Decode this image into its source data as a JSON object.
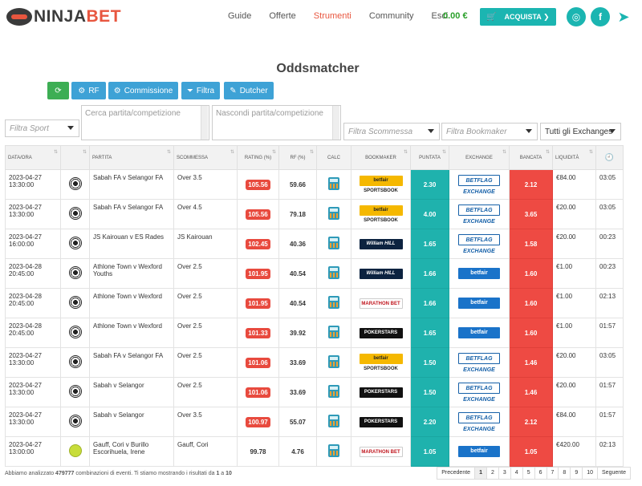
{
  "nav": {
    "logo_prefix": "NINJA",
    "logo_suffix": "BET",
    "links": [
      "Guide",
      "Offerte",
      "Strumenti",
      "Community",
      "Esci"
    ],
    "active_link": "Strumenti",
    "balance": "0.00 €",
    "buy_label": "ACQUISTA ❯",
    "social": [
      "instagram-icon",
      "facebook-icon",
      "telegram-icon"
    ]
  },
  "title": "Oddsmatcher",
  "toolbar": {
    "rf_label": "RF",
    "commission_label": "Commissione",
    "filter_label": "Filtra",
    "dutcher_label": "Dutcher"
  },
  "filters": {
    "sport_placeholder": "Filtra Sport",
    "search_placeholder": "Cerca partita/competizione",
    "hide_placeholder": "Nascondi partita/competizione",
    "bet_placeholder": "Filtra Scommessa",
    "bookmaker_placeholder": "Filtra Bookmaker",
    "exchange_value": "Tutti gli Exchanges"
  },
  "table": {
    "headers": [
      "DATA/ORA",
      "",
      "PARTITA",
      "SCOMMESSA",
      "RATING (%)",
      "RF (%)",
      "CALC",
      "BOOKMAKER",
      "PUNTATA",
      "EXCHANGE",
      "BANCATA",
      "LIQUIDITÀ",
      ""
    ],
    "rows": [
      {
        "date": "2023-04-27",
        "time": "13:30:00",
        "sport": "football",
        "match": "Sabah FA v Selangor FA",
        "bet": "Over 3.5",
        "rating": "105.56",
        "rating_hl": true,
        "rf": "59.66",
        "bookmaker": "betfair SPORTSBOOK",
        "bk": "betfair-sb",
        "back": "2.30",
        "exchange": "BETFLAG EXCHANGE",
        "ex": "betflag",
        "lay": "2.12",
        "liquidity": "€84.00",
        "clock": "03:05"
      },
      {
        "date": "2023-04-27",
        "time": "13:30:00",
        "sport": "football",
        "match": "Sabah FA v Selangor FA",
        "bet": "Over 4.5",
        "rating": "105.56",
        "rating_hl": true,
        "rf": "79.18",
        "bookmaker": "betfair SPORTSBOOK",
        "bk": "betfair-sb",
        "back": "4.00",
        "exchange": "BETFLAG EXCHANGE",
        "ex": "betflag",
        "lay": "3.65",
        "liquidity": "€20.00",
        "clock": "03:05"
      },
      {
        "date": "2023-04-27",
        "time": "16:00:00",
        "sport": "football",
        "match": "JS Kairouan v ES Rades",
        "bet": "JS Kairouan",
        "rating": "102.45",
        "rating_hl": true,
        "rf": "40.36",
        "bookmaker": "William HILL",
        "bk": "williamhill",
        "back": "1.65",
        "exchange": "BETFLAG EXCHANGE",
        "ex": "betflag",
        "lay": "1.58",
        "liquidity": "€20.00",
        "clock": "00:23"
      },
      {
        "date": "2023-04-28",
        "time": "20:45:00",
        "sport": "football",
        "match": "Athlone Town v Wexford Youths",
        "bet": "Over 2.5",
        "rating": "101.95",
        "rating_hl": true,
        "rf": "40.54",
        "bookmaker": "William HILL",
        "bk": "williamhill",
        "back": "1.66",
        "exchange": "betfair",
        "ex": "betfair",
        "lay": "1.60",
        "liquidity": "€1.00",
        "clock": "00:23"
      },
      {
        "date": "2023-04-28",
        "time": "20:45:00",
        "sport": "football",
        "match": "Athlone Town v Wexford",
        "bet": "Over 2.5",
        "rating": "101.95",
        "rating_hl": true,
        "rf": "40.54",
        "bookmaker": "MARATHON BET",
        "bk": "marathon",
        "back": "1.66",
        "exchange": "betfair",
        "ex": "betfair",
        "lay": "1.60",
        "liquidity": "€1.00",
        "clock": "02:13"
      },
      {
        "date": "2023-04-28",
        "time": "20:45:00",
        "sport": "football",
        "match": "Athlone Town v Wexford",
        "bet": "Over 2.5",
        "rating": "101.33",
        "rating_hl": true,
        "rf": "39.92",
        "bookmaker": "POKERSTARS",
        "bk": "pokerstars",
        "back": "1.65",
        "exchange": "betfair",
        "ex": "betfair",
        "lay": "1.60",
        "liquidity": "€1.00",
        "clock": "01:57"
      },
      {
        "date": "2023-04-27",
        "time": "13:30:00",
        "sport": "football",
        "match": "Sabah FA v Selangor FA",
        "bet": "Over 2.5",
        "rating": "101.06",
        "rating_hl": true,
        "rf": "33.69",
        "bookmaker": "betfair SPORTSBOOK",
        "bk": "betfair-sb",
        "back": "1.50",
        "exchange": "BETFLAG EXCHANGE",
        "ex": "betflag",
        "lay": "1.46",
        "liquidity": "€20.00",
        "clock": "03:05"
      },
      {
        "date": "2023-04-27",
        "time": "13:30:00",
        "sport": "football",
        "match": "Sabah v Selangor",
        "bet": "Over 2.5",
        "rating": "101.06",
        "rating_hl": true,
        "rf": "33.69",
        "bookmaker": "POKERSTARS",
        "bk": "pokerstars",
        "back": "1.50",
        "exchange": "BETFLAG EXCHANGE",
        "ex": "betflag",
        "lay": "1.46",
        "liquidity": "€20.00",
        "clock": "01:57"
      },
      {
        "date": "2023-04-27",
        "time": "13:30:00",
        "sport": "football",
        "match": "Sabah v Selangor",
        "bet": "Over 3.5",
        "rating": "100.97",
        "rating_hl": true,
        "rf": "55.07",
        "bookmaker": "POKERSTARS",
        "bk": "pokerstars",
        "back": "2.20",
        "exchange": "BETFLAG EXCHANGE",
        "ex": "betflag",
        "lay": "2.12",
        "liquidity": "€84.00",
        "clock": "01:57"
      },
      {
        "date": "2023-04-27",
        "time": "13:00:00",
        "sport": "tennis",
        "match": "Gauff, Cori v Burillo Escorihuela, Irene",
        "bet": "Gauff, Cori",
        "rating": "99.78",
        "rating_hl": false,
        "rf": "4.76",
        "bookmaker": "MARATHON BET",
        "bk": "marathon",
        "back": "1.05",
        "exchange": "betfair",
        "ex": "betfair",
        "lay": "1.05",
        "liquidity": "€420.00",
        "clock": "02:13"
      }
    ]
  },
  "footer": {
    "prefix": "Abbiamo analizzato ",
    "count": "479777",
    "middle": " combinazioni di eventi. Ti stiamo mostrando i risultati da ",
    "from": "1",
    "sep": " a ",
    "to": "10"
  },
  "pager": {
    "prev": "Precedente",
    "pages": [
      "1",
      "2",
      "3",
      "4",
      "5",
      "6",
      "7",
      "8",
      "9",
      "10"
    ],
    "active": "1",
    "next": "Seguente"
  }
}
